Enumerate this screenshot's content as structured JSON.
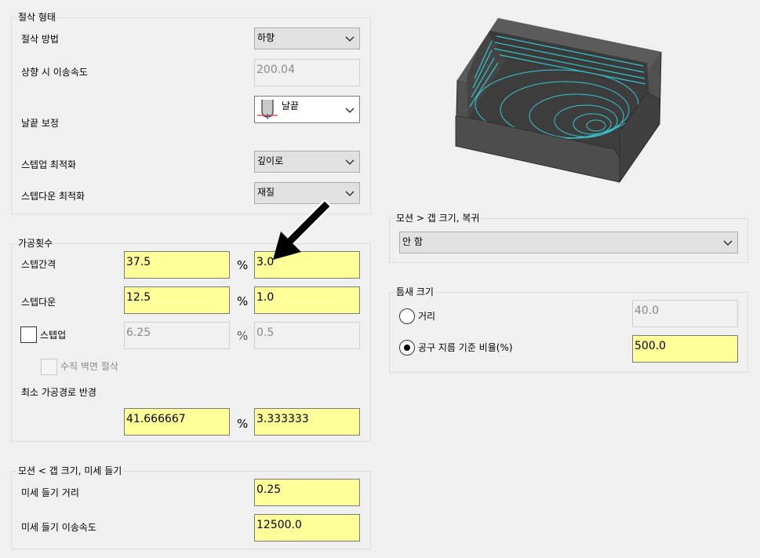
{
  "cut_form": {
    "title": "절삭 형태",
    "cut_method": {
      "label": "절삭 방법",
      "value": "하향"
    },
    "upward_feedrate": {
      "label": "상향 시 이송속도",
      "value": "200.04"
    },
    "tip_compensation": {
      "label": "날끝 보정",
      "value": "날끝"
    },
    "stepup_opt": {
      "label": "스텝업 최적화",
      "value": "깊이로"
    },
    "stepdown_opt": {
      "label": "스텝다운 최적화",
      "value": "재질"
    }
  },
  "passes": {
    "title": "가공횟수",
    "stepover": {
      "label": "스텝간격",
      "percent": "37.5",
      "value": "3.0"
    },
    "stepdown": {
      "label": "스텝다운",
      "percent": "12.5",
      "value": "1.0"
    },
    "stepup": {
      "label": "스텝업",
      "percent": "6.25",
      "value": "0.5"
    },
    "vertical_wall": {
      "label": "수직 벽면 절삭"
    },
    "min_radius": {
      "label": "최소 가공경로 반경",
      "percent": "41.666667",
      "value": "3.333333"
    },
    "percent_symbol": "%"
  },
  "motion_lift": {
    "title": "모션 < 갭 크기, 미세 들기",
    "lift_distance": {
      "label": "미세 들기 거리",
      "value": "0.25"
    },
    "lift_feedrate": {
      "label": "미세 들기 이송속도",
      "value": "12500.0"
    }
  },
  "motion_return": {
    "title": "모션 > 갭 크기, 복귀",
    "value": "안 함"
  },
  "gap_size": {
    "title": "틈새 크기",
    "distance": {
      "label": "거리",
      "value": "40.0"
    },
    "tool_ratio": {
      "label": "공구 지름 기준 비율(%)",
      "value": "500.0"
    }
  },
  "colors": {
    "highlight_field": "#ffff99",
    "toolpath": "#35c6d0",
    "part": "#4a4a4a"
  },
  "icons": [
    "chevron-down-icon",
    "tip-tool-icon",
    "pointer-arrow-icon",
    "part-preview-image"
  ]
}
